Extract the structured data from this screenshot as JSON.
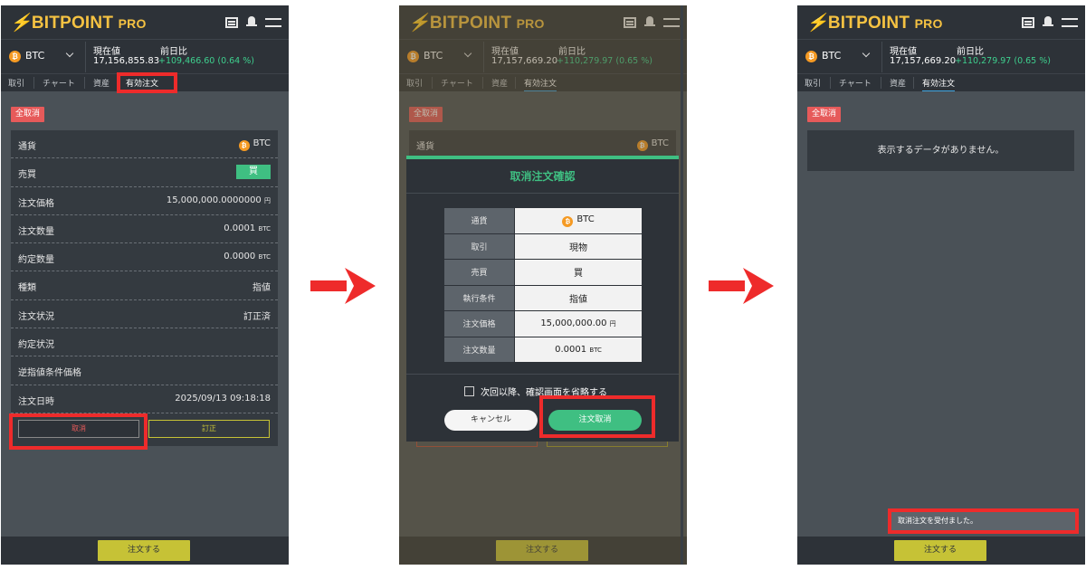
{
  "app": {
    "logo_main": "BITPOINT",
    "logo_sub": "PRO"
  },
  "ticker": {
    "coin": "BTC",
    "current_label": "現在値",
    "change_label": "前日比"
  },
  "tabs": [
    "取引",
    "チャート",
    "資産",
    "有効注文"
  ],
  "cancel_all": "全取消",
  "order_button": "注文する",
  "screens": [
    {
      "current_value": "17,156,855.83",
      "change_value": "+109,466.60 (0.64 %)",
      "details": [
        {
          "key": "通貨",
          "value": "BTC"
        },
        {
          "key": "売買",
          "value": "買"
        },
        {
          "key": "注文価格",
          "value": "15,000,000.0000000",
          "unit": "円"
        },
        {
          "key": "注文数量",
          "value": "0.0001",
          "unit": "BTC"
        },
        {
          "key": "約定数量",
          "value": "0.0000",
          "unit": "BTC"
        },
        {
          "key": "種類",
          "value": "指値"
        },
        {
          "key": "注文状況",
          "value": "訂正済"
        },
        {
          "key": "約定状況",
          "value": ""
        },
        {
          "key": "逆指値条件価格",
          "value": ""
        },
        {
          "key": "注文日時",
          "value": "2025/09/13 09:18:18"
        }
      ],
      "cancel_button": "取消",
      "amend_button": "訂正"
    },
    {
      "current_value": "17,157,669.20",
      "change_value": "+110,279.97 (0.65 %)",
      "bg_row_key": "通貨",
      "bg_row_value": "BTC",
      "modal": {
        "title": "取消注文確認",
        "rows": [
          {
            "key": "通貨",
            "value": "BTC"
          },
          {
            "key": "取引",
            "value": "現物"
          },
          {
            "key": "売買",
            "value": "買"
          },
          {
            "key": "執行条件",
            "value": "指値"
          },
          {
            "key": "注文価格",
            "value": "15,000,000.00",
            "unit": "円"
          },
          {
            "key": "注文数量",
            "value": "0.0001",
            "unit": "BTC"
          }
        ],
        "checkbox_label": "次回以降、確認画面を省略する",
        "cancel_label": "キャンセル",
        "confirm_label": "注文取消"
      }
    },
    {
      "current_value": "17,157,669.20",
      "change_value": "+110,279.97 (0.65 %)",
      "no_data": "表示するデータがありません。",
      "toast": "取消注文を受付ました。"
    }
  ],
  "colors": {
    "brand": "#f5c242",
    "highlight": "#ee2b2b",
    "positive": "#3ecf8e",
    "order": "#c6c236"
  }
}
